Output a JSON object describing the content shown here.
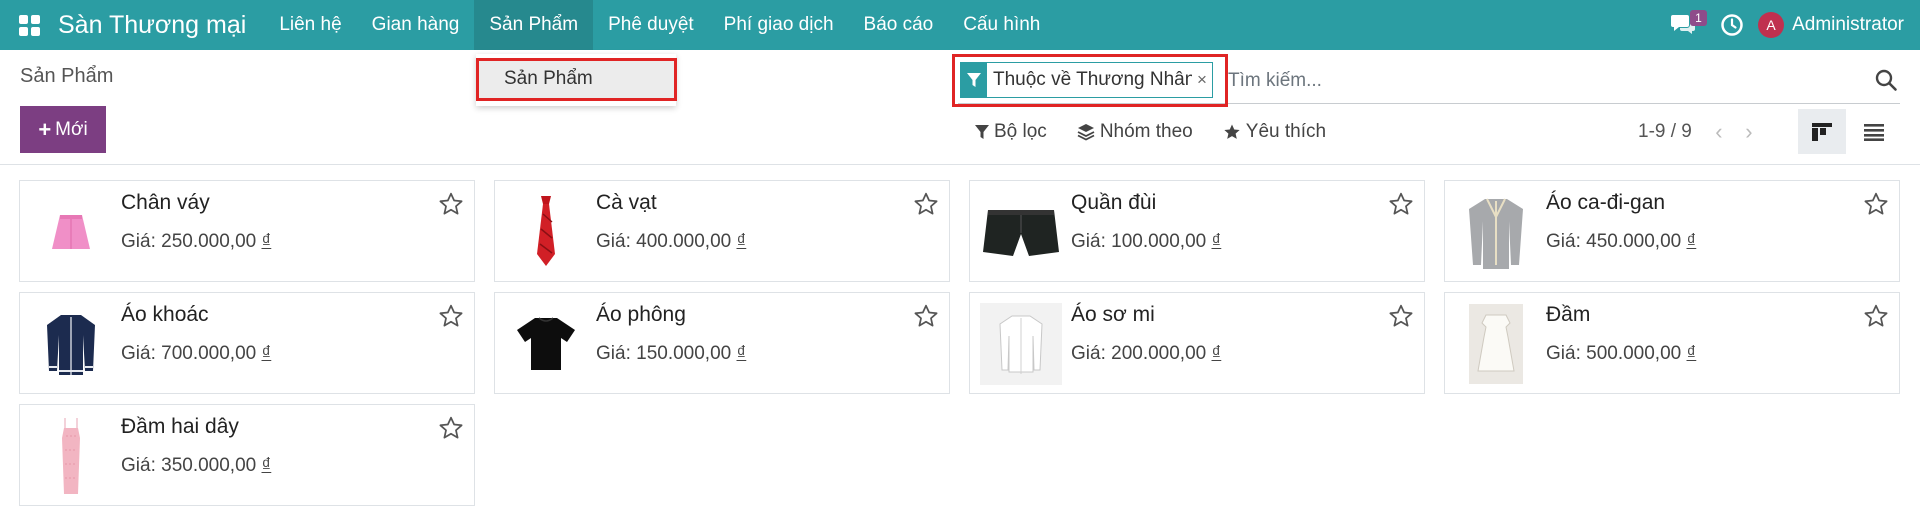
{
  "navbar": {
    "brand": "Sàn Thương mại",
    "menu": [
      "Liên hệ",
      "Gian hàng",
      "Sản Phẩm",
      "Phê duyệt",
      "Phí giao dịch",
      "Báo cáo",
      "Cấu hình"
    ],
    "active_menu": "Sản Phẩm",
    "chat_badge": "1",
    "avatar_letter": "A",
    "user": "Administrator"
  },
  "dropdown": {
    "item": "Sản Phẩm"
  },
  "control_panel": {
    "breadcrumb": "Sản Phẩm",
    "new_button": "Mới",
    "search": {
      "facet": "Thuộc về Thương Nhân",
      "placeholder": "Tìm kiếm..."
    },
    "filters": {
      "filter": "Bộ lọc",
      "group_by": "Nhóm theo",
      "favorites": "Yêu thích"
    },
    "pager": "1-9 / 9"
  },
  "products": [
    {
      "name": "Chân váy",
      "price_label": "Giá: 250.000,00",
      "currency": "₫",
      "icon": "skirt-icon"
    },
    {
      "name": "Cà vạt",
      "price_label": "Giá: 400.000,00",
      "currency": "₫",
      "icon": "tie-icon"
    },
    {
      "name": "Quần đùi",
      "price_label": "Giá: 100.000,00",
      "currency": "₫",
      "icon": "shorts-icon"
    },
    {
      "name": "Áo ca-đi-gan",
      "price_label": "Giá: 450.000,00",
      "currency": "₫",
      "icon": "cardigan-icon"
    },
    {
      "name": "Áo khoác",
      "price_label": "Giá: 700.000,00",
      "currency": "₫",
      "icon": "jacket-icon"
    },
    {
      "name": "Áo phông",
      "price_label": "Giá: 150.000,00",
      "currency": "₫",
      "icon": "tshirt-icon"
    },
    {
      "name": "Áo sơ mi",
      "price_label": "Giá: 200.000,00",
      "currency": "₫",
      "icon": "shirt-icon"
    },
    {
      "name": "Đầm",
      "price_label": "Giá: 500.000,00",
      "currency": "₫",
      "icon": "dress-icon"
    },
    {
      "name": "Đầm hai dây",
      "price_label": "Giá: 350.000,00",
      "currency": "₫",
      "icon": "slip-dress-icon"
    }
  ],
  "colors": {
    "navbar": "#2b9da3",
    "primary": "#7c3e82",
    "highlight": "#e02424"
  }
}
